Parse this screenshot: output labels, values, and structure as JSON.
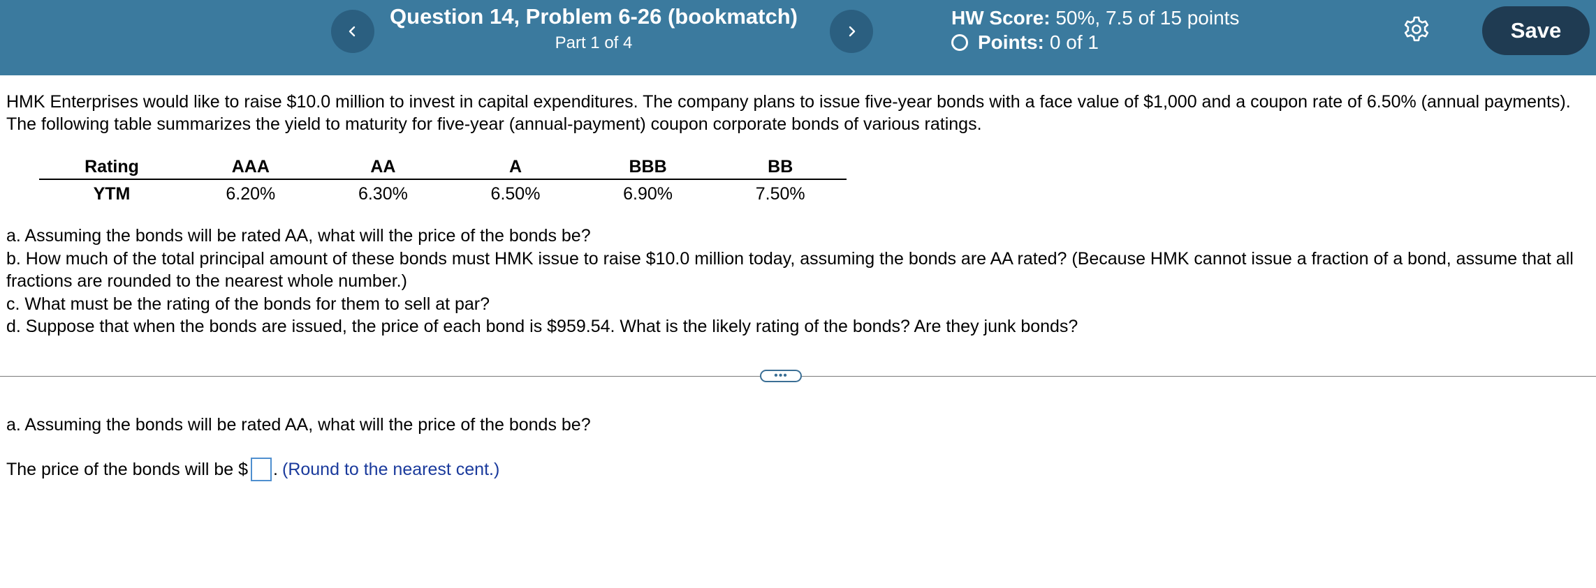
{
  "header": {
    "title": "Question 14, Problem 6-26 (bookmatch)",
    "part": "Part 1 of 4",
    "hw_score_label": "HW Score:",
    "hw_score_value": "50%, 7.5 of 15 points",
    "points_label": "Points:",
    "points_value": "0 of 1",
    "save_label": "Save",
    "prev_icon": "chevron-left-icon",
    "next_icon": "chevron-right-icon",
    "settings_icon": "gear-icon",
    "colors": {
      "header_bg": "#3b7a9e",
      "nav_button_bg": "#2b5f80",
      "save_button_bg": "#1f3b52"
    }
  },
  "problem": {
    "intro": "HMK Enterprises would like to raise $10.0 million to invest in capital expenditures. The company plans to issue five-year bonds with a face value of $1,000 and a coupon rate of 6.50% (annual payments). The following table summarizes the yield to maturity for five-year (annual-payment) coupon corporate bonds of various ratings.",
    "table": {
      "header_label": "Rating",
      "row_label": "YTM",
      "ratings": [
        "AAA",
        "AA",
        "A",
        "BBB",
        "BB"
      ],
      "ytm": [
        "6.20%",
        "6.30%",
        "6.50%",
        "6.90%",
        "7.50%"
      ]
    },
    "questions": {
      "a": "a. Assuming the bonds will be rated AA, what will the price of the bonds be?",
      "b": "b. How much of the total principal amount of these bonds must HMK issue to raise $10.0 million today, assuming the bonds are AA rated? (Because HMK cannot issue a fraction of a bond, assume that all fractions are rounded to the nearest whole number.)",
      "c": "c. What must be the rating of the bonds for them to sell at par?",
      "d": "d. Suppose that when the bonds are issued, the price of each bond is $959.54. What is the likely rating of the bonds? Are they junk bonds?"
    }
  },
  "divider": {
    "handle_text": "•••"
  },
  "answer": {
    "question": "a. Assuming the bonds will be rated AA, what will the price of the bonds be?",
    "prefix": "The price of the bonds will be $",
    "input_value": "",
    "suffix": ".",
    "hint": "(Round to the nearest cent.)",
    "hint_color": "#1a3a9c"
  }
}
